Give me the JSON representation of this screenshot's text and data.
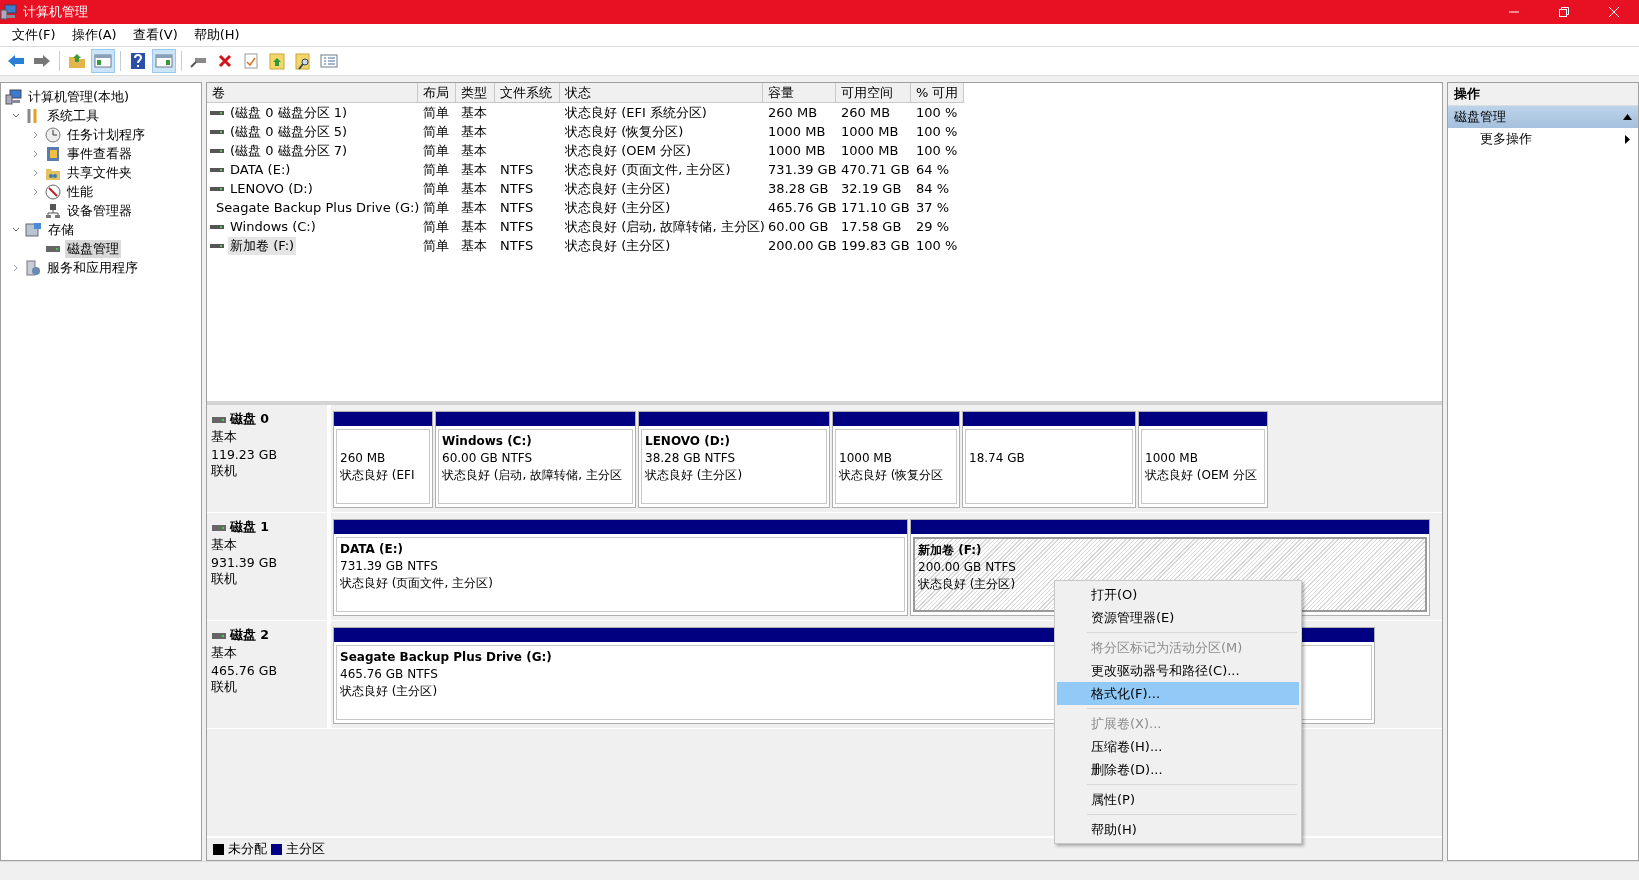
{
  "window": {
    "title": "计算机管理"
  },
  "menu": [
    "文件(F)",
    "操作(A)",
    "查看(V)",
    "帮助(H)"
  ],
  "toolbar": [
    {
      "kind": "back",
      "pressed": false
    },
    {
      "kind": "forward",
      "pressed": false
    },
    {
      "kind": "up",
      "pressed": false
    },
    {
      "kind": "tree",
      "pressed": true
    },
    {
      "kind": "help",
      "pressed": false
    },
    {
      "kind": "pane",
      "pressed": true
    },
    {
      "kind": "connect",
      "pressed": false
    },
    {
      "kind": "delete",
      "pressed": false
    },
    {
      "kind": "properties",
      "pressed": false
    },
    {
      "kind": "export",
      "pressed": false
    },
    {
      "kind": "find",
      "pressed": false
    },
    {
      "kind": "list",
      "pressed": false
    }
  ],
  "tree": [
    {
      "label": "计算机管理(本地)",
      "selected": false,
      "children": [
        {
          "label": "系统工具",
          "expanded": true,
          "selected": false,
          "children": [
            {
              "label": "任务计划程序",
              "expanded": false,
              "selected": false
            },
            {
              "label": "事件查看器",
              "expanded": false,
              "selected": false
            },
            {
              "label": "共享文件夹",
              "expanded": false,
              "selected": false
            },
            {
              "label": "性能",
              "expanded": false,
              "selected": false
            },
            {
              "label": "设备管理器",
              "selected": false
            }
          ]
        },
        {
          "label": "存储",
          "expanded": true,
          "selected": false,
          "children": [
            {
              "label": "磁盘管理",
              "selected": true
            }
          ]
        },
        {
          "label": "服务和应用程序",
          "expanded": false,
          "selected": false
        }
      ]
    }
  ],
  "table": {
    "columns": [
      "卷",
      "布局",
      "类型",
      "文件系统",
      "状态",
      "容量",
      "可用空间",
      "% 可用"
    ],
    "rows": [
      {
        "selected": false,
        "cells": [
          "(磁盘 0 磁盘分区 1)",
          "简单",
          "基本",
          null,
          "状态良好 (EFI 系统分区)",
          "260 MB",
          "260 MB",
          "100 %"
        ]
      },
      {
        "selected": false,
        "cells": [
          "(磁盘 0 磁盘分区 5)",
          "简单",
          "基本",
          null,
          "状态良好 (恢复分区)",
          "1000 MB",
          "1000 MB",
          "100 %"
        ]
      },
      {
        "selected": false,
        "cells": [
          "(磁盘 0 磁盘分区 7)",
          "简单",
          "基本",
          null,
          "状态良好 (OEM 分区)",
          "1000 MB",
          "1000 MB",
          "100 %"
        ]
      },
      {
        "selected": false,
        "cells": [
          "DATA (E:)",
          "简单",
          "基本",
          "NTFS",
          "状态良好 (页面文件, 主分区)",
          "731.39 GB",
          "470.71 GB",
          "64 %"
        ]
      },
      {
        "selected": false,
        "cells": [
          "LENOVO (D:)",
          "简单",
          "基本",
          "NTFS",
          "状态良好 (主分区)",
          "38.28 GB",
          "32.19 GB",
          "84 %"
        ]
      },
      {
        "selected": false,
        "cells": [
          "Seagate Backup Plus Drive (G:)",
          "简单",
          "基本",
          "NTFS",
          "状态良好 (主分区)",
          "465.76 GB",
          "171.10 GB",
          "37 %"
        ]
      },
      {
        "selected": false,
        "cells": [
          "Windows (C:)",
          "简单",
          "基本",
          "NTFS",
          "状态良好 (启动, 故障转储, 主分区)",
          "60.00 GB",
          "17.58 GB",
          "29 %"
        ]
      },
      {
        "selected": true,
        "cells": [
          "新加卷 (F:)",
          "简单",
          "基本",
          "NTFS",
          "状态良好 (主分区)",
          "200.00 GB",
          "199.83 GB",
          "100 %"
        ]
      }
    ]
  },
  "disks": [
    {
      "name": "磁盘 0",
      "type": "基本",
      "size": "119.23 GB",
      "status": "联机",
      "partitions": [
        {
          "size": "260 MB",
          "status": "状态良好 (EFI",
          "selected": false
        },
        {
          "name": "Windows  (C:)",
          "size": "60.00 GB NTFS",
          "status": "状态良好 (启动, 故障转储, 主分区",
          "selected": false
        },
        {
          "name": "LENOVO  (D:)",
          "size": "38.28 GB NTFS",
          "status": "状态良好 (主分区)",
          "selected": false
        },
        {
          "size": "1000 MB",
          "status": "状态良好 (恢复分区",
          "selected": false
        },
        {
          "size": "18.74 GB",
          "selected": false
        },
        {
          "size": "1000 MB",
          "status": "状态良好 (OEM 分区",
          "selected": false
        }
      ]
    },
    {
      "name": "磁盘 1",
      "type": "基本",
      "size": "931.39 GB",
      "status": "联机",
      "partitions": [
        {
          "name": "DATA  (E:)",
          "size": "731.39 GB NTFS",
          "status": "状态良好 (页面文件, 主分区)",
          "selected": false
        },
        {
          "name": "新加卷  (F:)",
          "size": "200.00 GB NTFS",
          "status": "状态良好 (主分区)",
          "selected": true
        }
      ]
    },
    {
      "name": "磁盘 2",
      "type": "基本",
      "size": "465.76 GB",
      "status": "联机",
      "partitions": [
        {
          "name": "Seagate Backup Plus Drive  (G:)",
          "size": "465.76 GB NTFS",
          "status": "状态良好 (主分区)",
          "selected": false
        }
      ]
    }
  ],
  "legend": [
    {
      "label": "未分配",
      "color": "#000000"
    },
    {
      "label": "主分区",
      "color": "#000080"
    }
  ],
  "actions": {
    "title": "操作",
    "sections": [
      {
        "label": "磁盘管理",
        "expanded": true,
        "items": [
          "更多操作"
        ]
      }
    ]
  },
  "context_menu": {
    "groups": [
      [
        {
          "label": "打开(O)",
          "disabled": false,
          "selected": false
        },
        {
          "label": "资源管理器(E)",
          "disabled": false,
          "selected": false
        }
      ],
      [
        {
          "label": "将分区标记为活动分区(M)",
          "disabled": true,
          "selected": false
        },
        {
          "label": "更改驱动器号和路径(C)...",
          "disabled": false,
          "selected": false
        },
        {
          "label": "格式化(F)...",
          "disabled": false,
          "selected": true
        }
      ],
      [
        {
          "label": "扩展卷(X)...",
          "disabled": true,
          "selected": false
        },
        {
          "label": "压缩卷(H)...",
          "disabled": false,
          "selected": false
        },
        {
          "label": "删除卷(D)...",
          "disabled": false,
          "selected": false
        }
      ],
      [
        {
          "label": "属性(P)",
          "disabled": false,
          "selected": false
        }
      ],
      [
        {
          "label": "帮助(H)",
          "disabled": false,
          "selected": false
        }
      ]
    ]
  }
}
